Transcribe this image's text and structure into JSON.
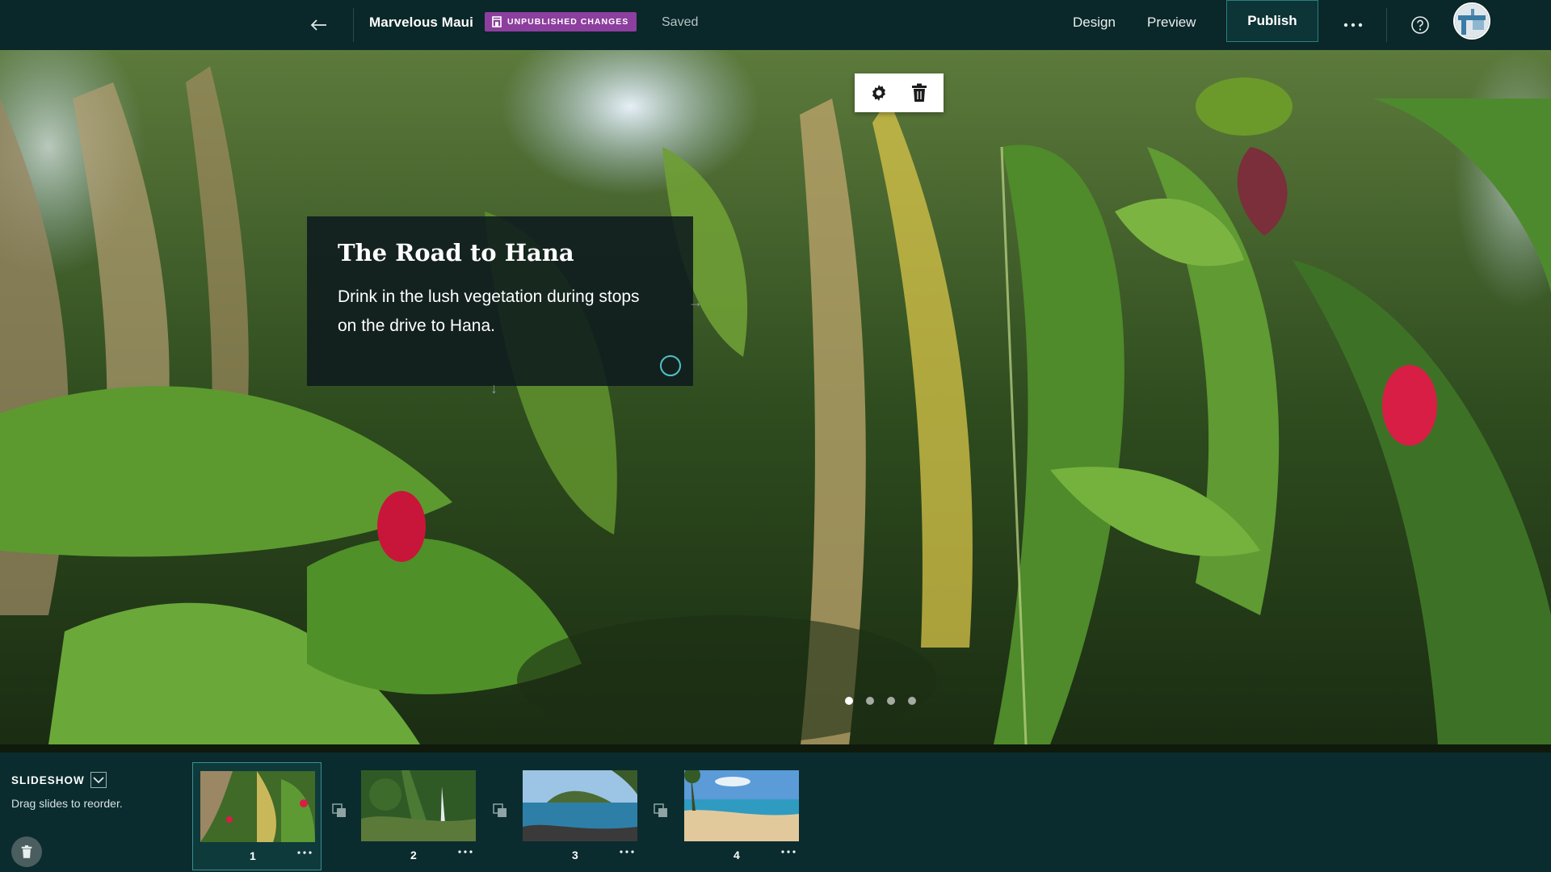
{
  "header": {
    "back_icon": "arrow-left-icon",
    "title": "Marvelous Maui",
    "badge_label": "UNPUBLISHED CHANGES",
    "badge_icon": "storefront-icon",
    "badge_color": "#8c3f9e",
    "saved_status": "Saved",
    "design_label": "Design",
    "preview_label": "Preview",
    "publish_label": "Publish",
    "more_icon": "ellipsis-icon",
    "help_icon": "question-circle-icon",
    "avatar_icon": "user-avatar"
  },
  "slide": {
    "title": "The Road to Hana",
    "body": "Drink in the lush vegetation during stops on the drive to Hana.",
    "toolbar": {
      "settings_icon": "gear-icon",
      "delete_icon": "trash-icon"
    },
    "pagination": {
      "count": 4,
      "active": 1
    }
  },
  "strip": {
    "section_label": "SLIDESHOW",
    "hint": "Drag slides to reorder.",
    "delete_icon": "trash-icon",
    "slides": [
      {
        "number": "1",
        "selected": true
      },
      {
        "number": "2",
        "selected": false
      },
      {
        "number": "3",
        "selected": false
      },
      {
        "number": "4",
        "selected": false
      }
    ]
  },
  "colors": {
    "topbar_bg": "#0a2729",
    "strip_bg": "#0a2c2e",
    "accent_teal": "#3c8f92"
  }
}
